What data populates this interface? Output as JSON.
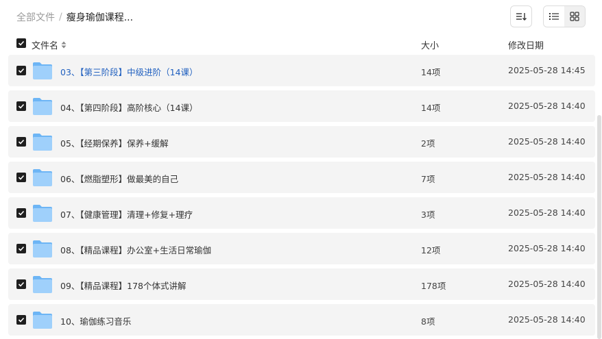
{
  "breadcrumb": {
    "root": "全部文件",
    "separator": "/",
    "current": "瘦身瑜伽课程..."
  },
  "toolbar": {
    "sort_icon": "sort-lines-icon",
    "list_view_icon": "list-view-icon",
    "grid_view_icon": "grid-view-icon"
  },
  "header": {
    "name": "文件名",
    "size": "大小",
    "modified": "修改日期"
  },
  "rows": [
    {
      "name": "03、【第三阶段】中级进阶（14课）",
      "size": "14项",
      "date": "2025-05-28 14:45",
      "checked": true,
      "highlight": true
    },
    {
      "name": "04、【第四阶段】高阶核心（14课）",
      "size": "14项",
      "date": "2025-05-28 14:40",
      "checked": true
    },
    {
      "name": "05、【经期保养】保养+缓解",
      "size": "2项",
      "date": "2025-05-28 14:40",
      "checked": true
    },
    {
      "name": "06、【燃脂塑形】做最美的自己",
      "size": "7项",
      "date": "2025-05-28 14:40",
      "checked": true
    },
    {
      "name": "07、【健康管理】清理+修复+理疗",
      "size": "3项",
      "date": "2025-05-28 14:40",
      "checked": true
    },
    {
      "name": "08、【精品课程】办公室+生活日常瑜伽",
      "size": "12项",
      "date": "2025-05-28 14:40",
      "checked": true
    },
    {
      "name": "09、【精品课程】178个体式讲解",
      "size": "178项",
      "date": "2025-05-28 14:40",
      "checked": true
    },
    {
      "name": "10、瑜伽练习音乐",
      "size": "8项",
      "date": "2025-05-28 14:40",
      "checked": true
    }
  ],
  "colors": {
    "row_bg": "#f4f4f4",
    "checkbox": "#1f1f1f",
    "highlight_text": "#1f5fbf",
    "folder_light": "#9fd0fb",
    "folder_dark": "#6db5f5"
  }
}
